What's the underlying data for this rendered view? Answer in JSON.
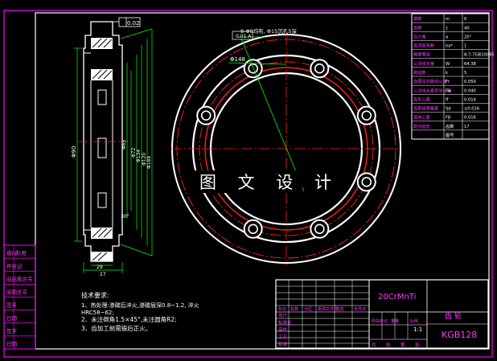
{
  "drawing": {
    "watermark": "图 文 设 计",
    "callouts": {
      "flatness": "0.02",
      "runout": "0.01 A",
      "bolt_holes": "8-Φ9均布, Φ15沉孔5深",
      "pcd_circle": "Φ148"
    },
    "dimensions": {
      "d_Pf": "Φ90",
      "d_outer": "Φ134",
      "d1": "Φ65",
      "d2": "Φ72",
      "d3": "Φ120",
      "d4": "Φ188",
      "angle": "30°",
      "w1": "29",
      "w2": "27"
    }
  },
  "notes": {
    "title": "技术要求:",
    "lines": [
      "1、热处理:渗碳后淬火,渗碳层深0.8~1.2, 淬火",
      "  HRC58~62;",
      "2、未注倒角1.5×45°,未注圆角R2;",
      "3、齿加工前需锻后正火。"
    ]
  },
  "gear_table": {
    "rows": [
      [
        "模数",
        "m",
        "6"
      ],
      [
        "齿数",
        "z",
        "40"
      ],
      [
        "压力角",
        "α",
        "20°"
      ],
      [
        "齿顶高系数",
        "ha*",
        "1"
      ],
      [
        "精度等级",
        "",
        "8-7-7GB10095"
      ],
      [
        "公法线长度",
        "W",
        "64.38"
      ],
      [
        "跨齿数",
        "k",
        "5"
      ],
      [
        "齿圈径向跳动公差",
        "Fr",
        "0.050"
      ],
      [
        "公法线长度变动公差",
        "Fw",
        "0.040"
      ],
      [
        "齿形公差",
        "ff",
        "0.014"
      ],
      [
        "齿距极限偏差",
        "fpt",
        "±0.016"
      ],
      [
        "齿向公差",
        "Fβ",
        "0.016"
      ],
      [
        "配对齿轮",
        "齿数",
        "17"
      ],
      [
        "",
        "图号",
        ""
      ]
    ]
  },
  "title_block": {
    "material": "20CrMnTi",
    "part_name": "齿 轮",
    "drawing_no": "KGB128",
    "scale": "1:1",
    "row_labels": [
      "标记",
      "处数",
      "分区",
      "更改文件号",
      "签名",
      "年月日"
    ],
    "left_labels": [
      "设计",
      "标准化",
      "审核",
      "工艺",
      "批准"
    ],
    "bottom_labels": [
      "共",
      "张",
      "第",
      "张"
    ],
    "stage_labels": [
      "阶段标记",
      "重量",
      "比例"
    ]
  },
  "side_panel": {
    "labels": [
      "借(通)用",
      "件登记",
      "旧底图总号",
      "底图总号",
      "签名",
      "日期",
      "签字",
      "日期"
    ]
  },
  "colors": {
    "background": "#000000",
    "outline": "#ffffff",
    "hidden": "#ff2020",
    "dimension": "#00ff00",
    "frame": "#ff00ff",
    "text": "#ffff00",
    "highlight": "#ff3cff"
  }
}
